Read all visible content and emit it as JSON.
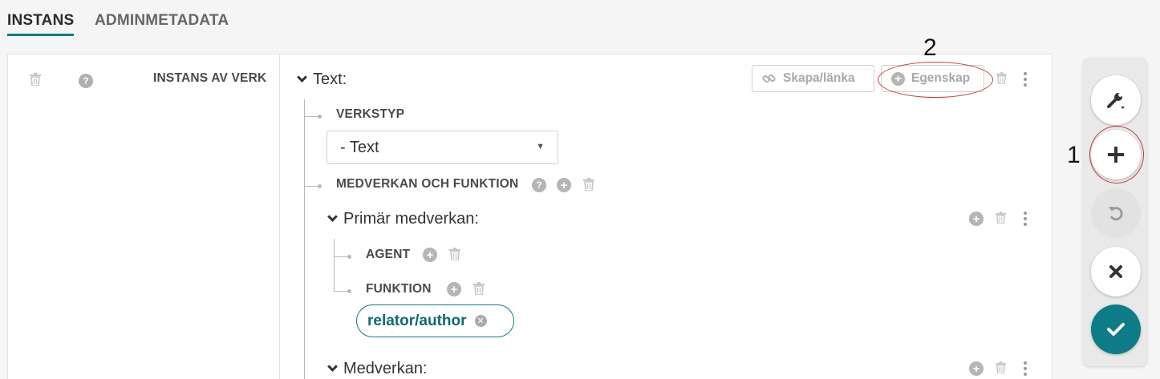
{
  "tabs": [
    {
      "label": "INSTANS"
    },
    {
      "label": "ADMINMETADATA"
    }
  ],
  "left": {
    "label": "INSTANS AV VERK"
  },
  "text_block": {
    "title": "Text:",
    "create_link_label": "Skapa/länka",
    "property_label": "Egenskap"
  },
  "verkstyp": {
    "label": "VERKSTYP",
    "selected": "- Text"
  },
  "medverkan_funktion": {
    "label": "MEDVERKAN OCH FUNKTION"
  },
  "primar": {
    "title": "Primär medverkan:",
    "agent_label": "AGENT",
    "funktion_label": "FUNKTION",
    "chip": "relator/author"
  },
  "medverkan": {
    "title": "Medverkan:"
  },
  "annotations": {
    "one": "1",
    "two": "2"
  },
  "colors": {
    "accent": "#0e7c86",
    "annotation": "#c83737"
  }
}
